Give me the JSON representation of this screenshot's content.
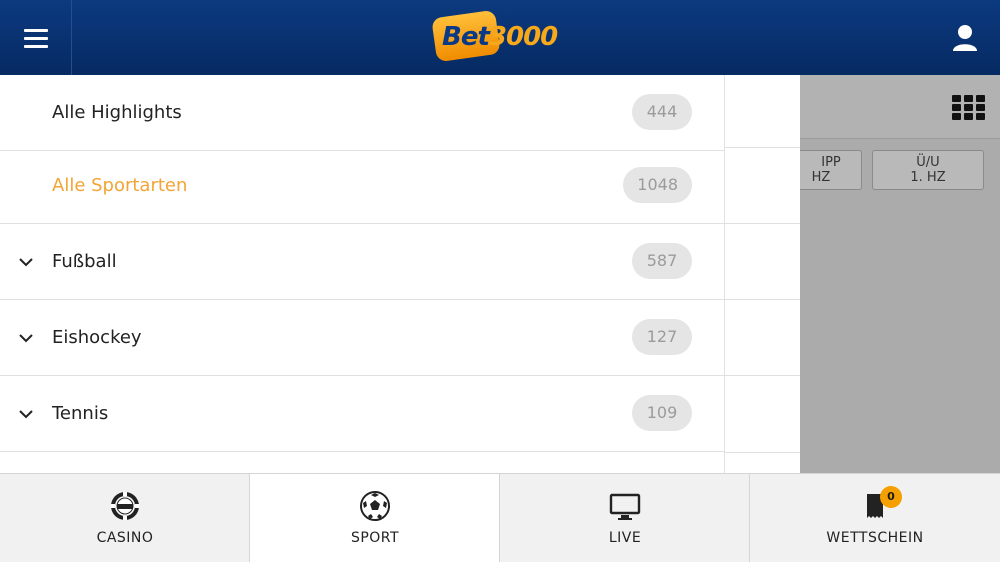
{
  "header": {
    "logo_text_primary": "Bet",
    "logo_text_secondary": "3000",
    "menu_icon": "hamburger-menu-icon",
    "user_icon": "user-icon"
  },
  "drawer": {
    "items": [
      {
        "label": "Alle Highlights",
        "count": "444",
        "active": false,
        "expandable": false
      },
      {
        "label": "Alle Sportarten",
        "count": "1048",
        "active": true,
        "expandable": false
      },
      {
        "label": "Fußball",
        "count": "587",
        "active": false,
        "expandable": true
      },
      {
        "label": "Eishockey",
        "count": "127",
        "active": false,
        "expandable": true
      },
      {
        "label": "Tennis",
        "count": "109",
        "active": false,
        "expandable": true
      }
    ]
  },
  "background": {
    "grid_icon": "grid-view-icon",
    "buttons": [
      {
        "line1": "IPP",
        "line2": "HZ"
      },
      {
        "line1": "Ü/U",
        "line2": "1. HZ"
      }
    ]
  },
  "bottom_nav": {
    "items": [
      {
        "label": "CASINO",
        "icon": "casino-chip-icon",
        "active": false
      },
      {
        "label": "SPORT",
        "icon": "soccer-ball-icon",
        "active": true
      },
      {
        "label": "LIVE",
        "icon": "monitor-icon",
        "active": false
      },
      {
        "label": "WETTSCHEIN",
        "icon": "betslip-icon",
        "active": false,
        "badge": "0"
      }
    ]
  },
  "colors": {
    "header_bg": "#0c3a80",
    "accent": "#f2a534",
    "badge": "#f5a000",
    "overlay": "#ababab"
  }
}
